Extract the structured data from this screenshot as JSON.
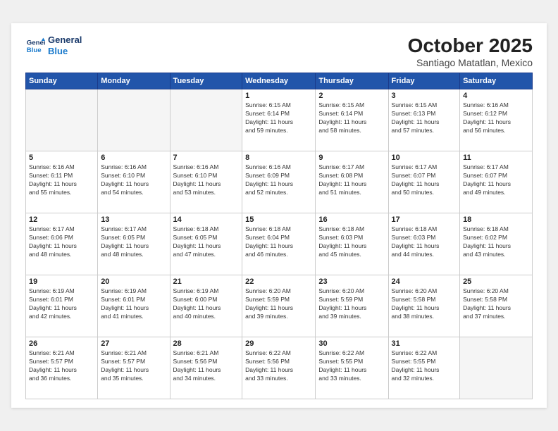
{
  "header": {
    "logo_line1": "General",
    "logo_line2": "Blue",
    "title": "October 2025",
    "subtitle": "Santiago Matatlan, Mexico"
  },
  "weekdays": [
    "Sunday",
    "Monday",
    "Tuesday",
    "Wednesday",
    "Thursday",
    "Friday",
    "Saturday"
  ],
  "weeks": [
    [
      {
        "day": "",
        "info": ""
      },
      {
        "day": "",
        "info": ""
      },
      {
        "day": "",
        "info": ""
      },
      {
        "day": "1",
        "info": "Sunrise: 6:15 AM\nSunset: 6:14 PM\nDaylight: 11 hours\nand 59 minutes."
      },
      {
        "day": "2",
        "info": "Sunrise: 6:15 AM\nSunset: 6:14 PM\nDaylight: 11 hours\nand 58 minutes."
      },
      {
        "day": "3",
        "info": "Sunrise: 6:15 AM\nSunset: 6:13 PM\nDaylight: 11 hours\nand 57 minutes."
      },
      {
        "day": "4",
        "info": "Sunrise: 6:16 AM\nSunset: 6:12 PM\nDaylight: 11 hours\nand 56 minutes."
      }
    ],
    [
      {
        "day": "5",
        "info": "Sunrise: 6:16 AM\nSunset: 6:11 PM\nDaylight: 11 hours\nand 55 minutes."
      },
      {
        "day": "6",
        "info": "Sunrise: 6:16 AM\nSunset: 6:10 PM\nDaylight: 11 hours\nand 54 minutes."
      },
      {
        "day": "7",
        "info": "Sunrise: 6:16 AM\nSunset: 6:10 PM\nDaylight: 11 hours\nand 53 minutes."
      },
      {
        "day": "8",
        "info": "Sunrise: 6:16 AM\nSunset: 6:09 PM\nDaylight: 11 hours\nand 52 minutes."
      },
      {
        "day": "9",
        "info": "Sunrise: 6:17 AM\nSunset: 6:08 PM\nDaylight: 11 hours\nand 51 minutes."
      },
      {
        "day": "10",
        "info": "Sunrise: 6:17 AM\nSunset: 6:07 PM\nDaylight: 11 hours\nand 50 minutes."
      },
      {
        "day": "11",
        "info": "Sunrise: 6:17 AM\nSunset: 6:07 PM\nDaylight: 11 hours\nand 49 minutes."
      }
    ],
    [
      {
        "day": "12",
        "info": "Sunrise: 6:17 AM\nSunset: 6:06 PM\nDaylight: 11 hours\nand 48 minutes."
      },
      {
        "day": "13",
        "info": "Sunrise: 6:17 AM\nSunset: 6:05 PM\nDaylight: 11 hours\nand 48 minutes."
      },
      {
        "day": "14",
        "info": "Sunrise: 6:18 AM\nSunset: 6:05 PM\nDaylight: 11 hours\nand 47 minutes."
      },
      {
        "day": "15",
        "info": "Sunrise: 6:18 AM\nSunset: 6:04 PM\nDaylight: 11 hours\nand 46 minutes."
      },
      {
        "day": "16",
        "info": "Sunrise: 6:18 AM\nSunset: 6:03 PM\nDaylight: 11 hours\nand 45 minutes."
      },
      {
        "day": "17",
        "info": "Sunrise: 6:18 AM\nSunset: 6:03 PM\nDaylight: 11 hours\nand 44 minutes."
      },
      {
        "day": "18",
        "info": "Sunrise: 6:18 AM\nSunset: 6:02 PM\nDaylight: 11 hours\nand 43 minutes."
      }
    ],
    [
      {
        "day": "19",
        "info": "Sunrise: 6:19 AM\nSunset: 6:01 PM\nDaylight: 11 hours\nand 42 minutes."
      },
      {
        "day": "20",
        "info": "Sunrise: 6:19 AM\nSunset: 6:01 PM\nDaylight: 11 hours\nand 41 minutes."
      },
      {
        "day": "21",
        "info": "Sunrise: 6:19 AM\nSunset: 6:00 PM\nDaylight: 11 hours\nand 40 minutes."
      },
      {
        "day": "22",
        "info": "Sunrise: 6:20 AM\nSunset: 5:59 PM\nDaylight: 11 hours\nand 39 minutes."
      },
      {
        "day": "23",
        "info": "Sunrise: 6:20 AM\nSunset: 5:59 PM\nDaylight: 11 hours\nand 39 minutes."
      },
      {
        "day": "24",
        "info": "Sunrise: 6:20 AM\nSunset: 5:58 PM\nDaylight: 11 hours\nand 38 minutes."
      },
      {
        "day": "25",
        "info": "Sunrise: 6:20 AM\nSunset: 5:58 PM\nDaylight: 11 hours\nand 37 minutes."
      }
    ],
    [
      {
        "day": "26",
        "info": "Sunrise: 6:21 AM\nSunset: 5:57 PM\nDaylight: 11 hours\nand 36 minutes."
      },
      {
        "day": "27",
        "info": "Sunrise: 6:21 AM\nSunset: 5:57 PM\nDaylight: 11 hours\nand 35 minutes."
      },
      {
        "day": "28",
        "info": "Sunrise: 6:21 AM\nSunset: 5:56 PM\nDaylight: 11 hours\nand 34 minutes."
      },
      {
        "day": "29",
        "info": "Sunrise: 6:22 AM\nSunset: 5:56 PM\nDaylight: 11 hours\nand 33 minutes."
      },
      {
        "day": "30",
        "info": "Sunrise: 6:22 AM\nSunset: 5:55 PM\nDaylight: 11 hours\nand 33 minutes."
      },
      {
        "day": "31",
        "info": "Sunrise: 6:22 AM\nSunset: 5:55 PM\nDaylight: 11 hours\nand 32 minutes."
      },
      {
        "day": "",
        "info": ""
      }
    ]
  ]
}
